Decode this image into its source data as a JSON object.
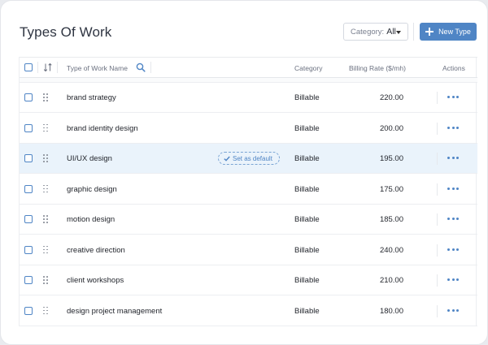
{
  "header": {
    "title": "Types Of Work",
    "category_label": "Category:",
    "category_value": "All",
    "new_type_label": "New Type"
  },
  "table": {
    "columns": {
      "name": "Type of Work Name",
      "category": "Category",
      "rate": "Billing Rate ($/mh)",
      "actions": "Actions"
    },
    "rows": [
      {
        "name": "brand strategy",
        "category": "Billable",
        "rate": "220.00"
      },
      {
        "name": "brand identity design",
        "category": "Billable",
        "rate": "200.00"
      },
      {
        "name": "UI/UX design",
        "category": "Billable",
        "rate": "195.00",
        "chip": "Set as default"
      },
      {
        "name": "graphic design",
        "category": "Billable",
        "rate": "175.00"
      },
      {
        "name": "motion design",
        "category": "Billable",
        "rate": "185.00"
      },
      {
        "name": "creative direction",
        "category": "Billable",
        "rate": "240.00"
      },
      {
        "name": "client workshops",
        "category": "Billable",
        "rate": "210.00"
      },
      {
        "name": "design project management",
        "category": "Billable",
        "rate": "180.00"
      }
    ]
  },
  "icons": {
    "sort": "sort-icon",
    "search": "search-icon",
    "drag": "drag-handle-icon",
    "more": "more-dots-icon",
    "check": "check-icon",
    "add": "plus-icon"
  },
  "colors": {
    "accent": "#4f85c5",
    "row_highlight": "#eaf3fb",
    "border": "#eceef1"
  }
}
